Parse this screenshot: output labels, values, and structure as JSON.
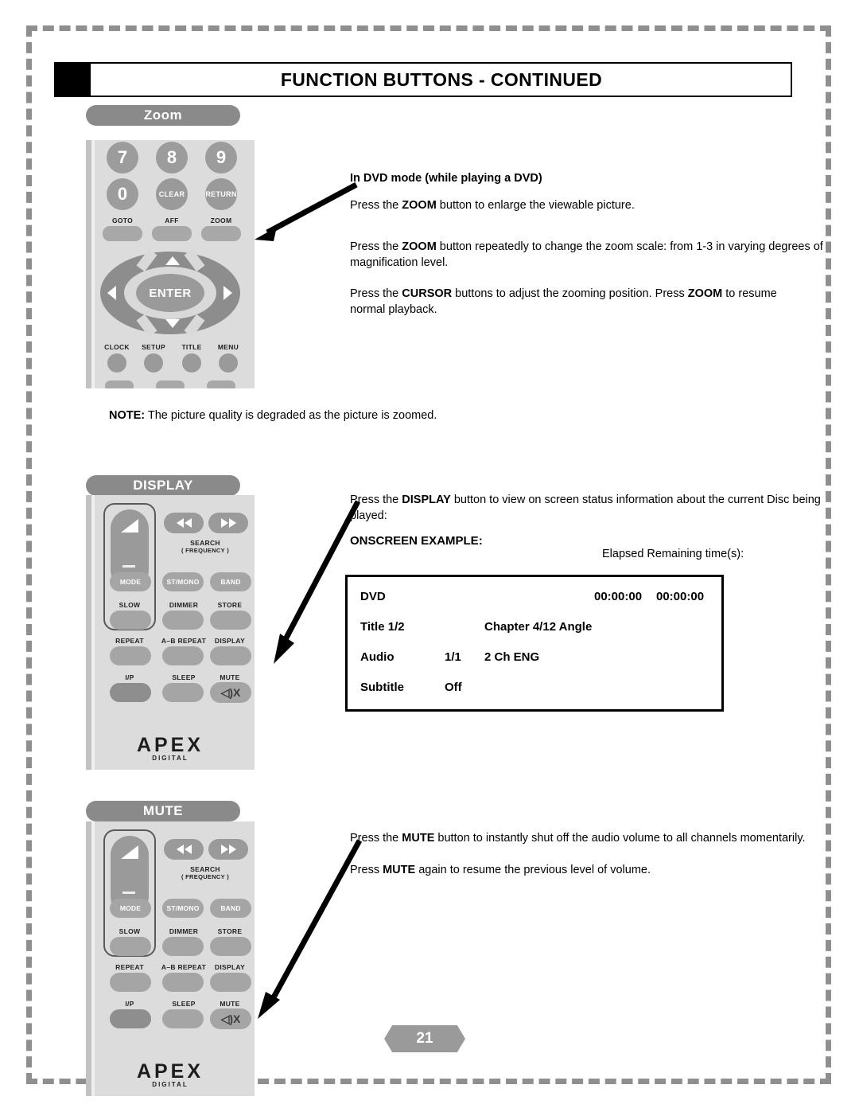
{
  "header": {
    "title": "FUNCTION BUTTONS - CONTINUED"
  },
  "sections": {
    "zoom": {
      "label": "Zoom",
      "heading": "In DVD mode (while playing a DVD)",
      "p1_pre": "Press the ",
      "p1_b": "ZOOM",
      "p1_post": " button to enlarge the viewable picture.",
      "p2_pre": "Press the ",
      "p2_b": "ZOOM",
      "p2_post": " button repeatedly to change the zoom scale: from 1-3 in varying degrees of magnification level.",
      "p3_pre": "Press the ",
      "p3_b1": "CURSOR",
      "p3_mid": " buttons to adjust the zooming position.  Press ",
      "p3_b2": "ZOOM",
      "p3_post": "  to resume normal playback.",
      "note_b": "NOTE:",
      "note_text": " The picture quality is degraded as the picture is zoomed."
    },
    "display": {
      "label": "DISPLAY",
      "p1_pre": "Press the ",
      "p1_b": "DISPLAY",
      "p1_post": " button to view on screen status information about the current Disc being played:",
      "onscreen_label": "ONSCREEN EXAMPLE:",
      "elapsed_header": "Elapsed   Remaining time(s):"
    },
    "mute": {
      "label": "MUTE",
      "p1_pre": "Press the ",
      "p1_b": "MUTE",
      "p1_post": " button to instantly shut off the audio volume to all channels momentarily.",
      "p2_pre": "Press ",
      "p2_b": "MUTE",
      "p2_post": " again to resume the previous level of volume."
    }
  },
  "osd": {
    "row1": {
      "label": "DVD",
      "elapsed": "00:00:00",
      "remaining": "00:00:00"
    },
    "row2": {
      "label": "Title  1/2",
      "chapter": "Chapter 4/12  Angle"
    },
    "row3": {
      "label": "Audio",
      "value": "1/1",
      "detail": "2 Ch  ENG"
    },
    "row4": {
      "label": "Subtitle",
      "value": "Off"
    }
  },
  "remote_top": {
    "numbers": [
      "7",
      "8",
      "9"
    ],
    "row2": [
      "0",
      "CLEAR",
      "RETURN"
    ],
    "row3": [
      "GOTO",
      "AFF",
      "ZOOM"
    ],
    "enter": "ENTER",
    "row4": [
      "CLOCK",
      "SETUP",
      "TITLE",
      "MENU"
    ]
  },
  "remote_low": {
    "search": "SEARCH",
    "frequency": "( FREQUENCY )",
    "row_mode": [
      "MODE",
      "ST/MONO",
      "BAND"
    ],
    "row_slow": [
      "SLOW",
      "DIMMER",
      "STORE"
    ],
    "row_repeat": [
      "REPEAT",
      "A–B REPEAT",
      "DISPLAY"
    ],
    "row_ip": [
      "I/P",
      "SLEEP",
      "MUTE"
    ],
    "mute_glyph": "◁)X",
    "brand": "APEX",
    "brand_sub": "DIGITAL"
  },
  "page_number": "21",
  "colors": {
    "pill": "#8a8a8a",
    "remote_body": "#dcdcdc",
    "button": "#9a9a9a",
    "frame": "#8f8f8f"
  }
}
